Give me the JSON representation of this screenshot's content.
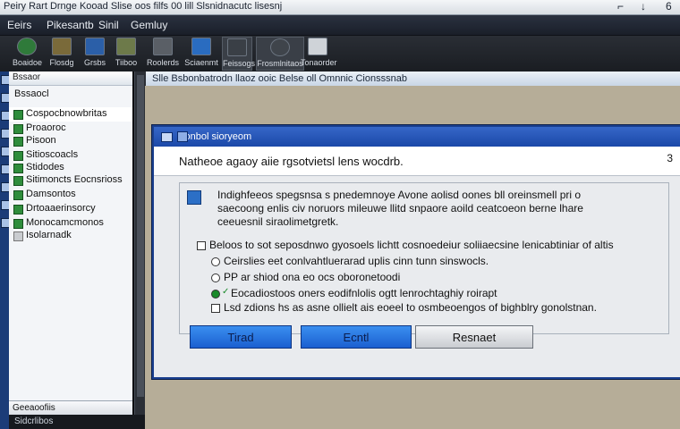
{
  "window": {
    "title": "Peiry Rart Drnge Kooad   Slise oos filfs     00 lill  Slsnidnacutc  lisesnj",
    "controls": [
      "⌐",
      "↓",
      "6"
    ]
  },
  "menu": [
    "Eeirs",
    "Pikesantb",
    "Sinil",
    "Gemluy"
  ],
  "toolbar": {
    "buttons": [
      {
        "label": "Boaidoe"
      },
      {
        "label": "Flosdg"
      },
      {
        "label": "Grsbs"
      },
      {
        "label": "Tiiboo"
      },
      {
        "label": "Roolerds"
      },
      {
        "label": "Sciaenmt"
      },
      {
        "label": "Feissogs"
      },
      {
        "label": "Frosmlnitaos"
      },
      {
        "label": "Tonaorder"
      }
    ]
  },
  "address": "Slle  Bsbonbatrodn  llaoz ooic  Belse  oll  Omnnic  Cionsssnab",
  "sidebar": {
    "header": "Bssaor",
    "subheader": "Bssaocl",
    "items": [
      "Cospocbnowbritas",
      "Proaoroc",
      "Pisoon",
      "Sitioscoacls",
      "Stidodes",
      "Sitimoncts  Eocnsrioss",
      "Damsontos",
      "Drtoaaerinsorcy",
      "Monocamcmonos",
      "Isolarnadk"
    ],
    "footer": "Geeaoofiis"
  },
  "bottom_label": "Sidcrlibos",
  "dialog": {
    "title": "Gonbol sioryeom",
    "heading": "Natheoe agaoy aiie rgsotvietsl lens wocdrb.",
    "number": "3",
    "message": "Indighfeeos spegsnsa s pnedemnoye  Avone aolisd oones  bll oreinsmell pri o saecoong enlis civ noruors mileuwe llitd snpaore aoild ceatcoeon berne lhare ceeuesnil  siraolimetgretk.",
    "options": [
      {
        "label": "Beloos to sot seposdnwo gyosoels lichtt cosnoedeiur soliiaecsine lenicabtiniar of altis",
        "kind": "checkbox",
        "state": "unchecked"
      },
      {
        "label": "Ceirslies eet conlvahtluerarad  uplis cinn tunn sinswocls.",
        "kind": "radio",
        "state": "unselected"
      },
      {
        "label": "PP ar shiod ona eo ocs oboronetoodi",
        "kind": "radio",
        "state": "unselected"
      },
      {
        "label": "Eocadiostoos oners eodifnlolis ogtt lenrochtaghiy roirapt",
        "kind": "radio",
        "state": "selected"
      },
      {
        "label": "Lsd  zdions hs as asne ollielt ais eoeel to osmbeoengos of bighblry gonolstnan.",
        "kind": "checkbox",
        "state": "unchecked"
      }
    ],
    "buttons": [
      "Tirad",
      "Ecntl",
      "Resnaet"
    ]
  }
}
